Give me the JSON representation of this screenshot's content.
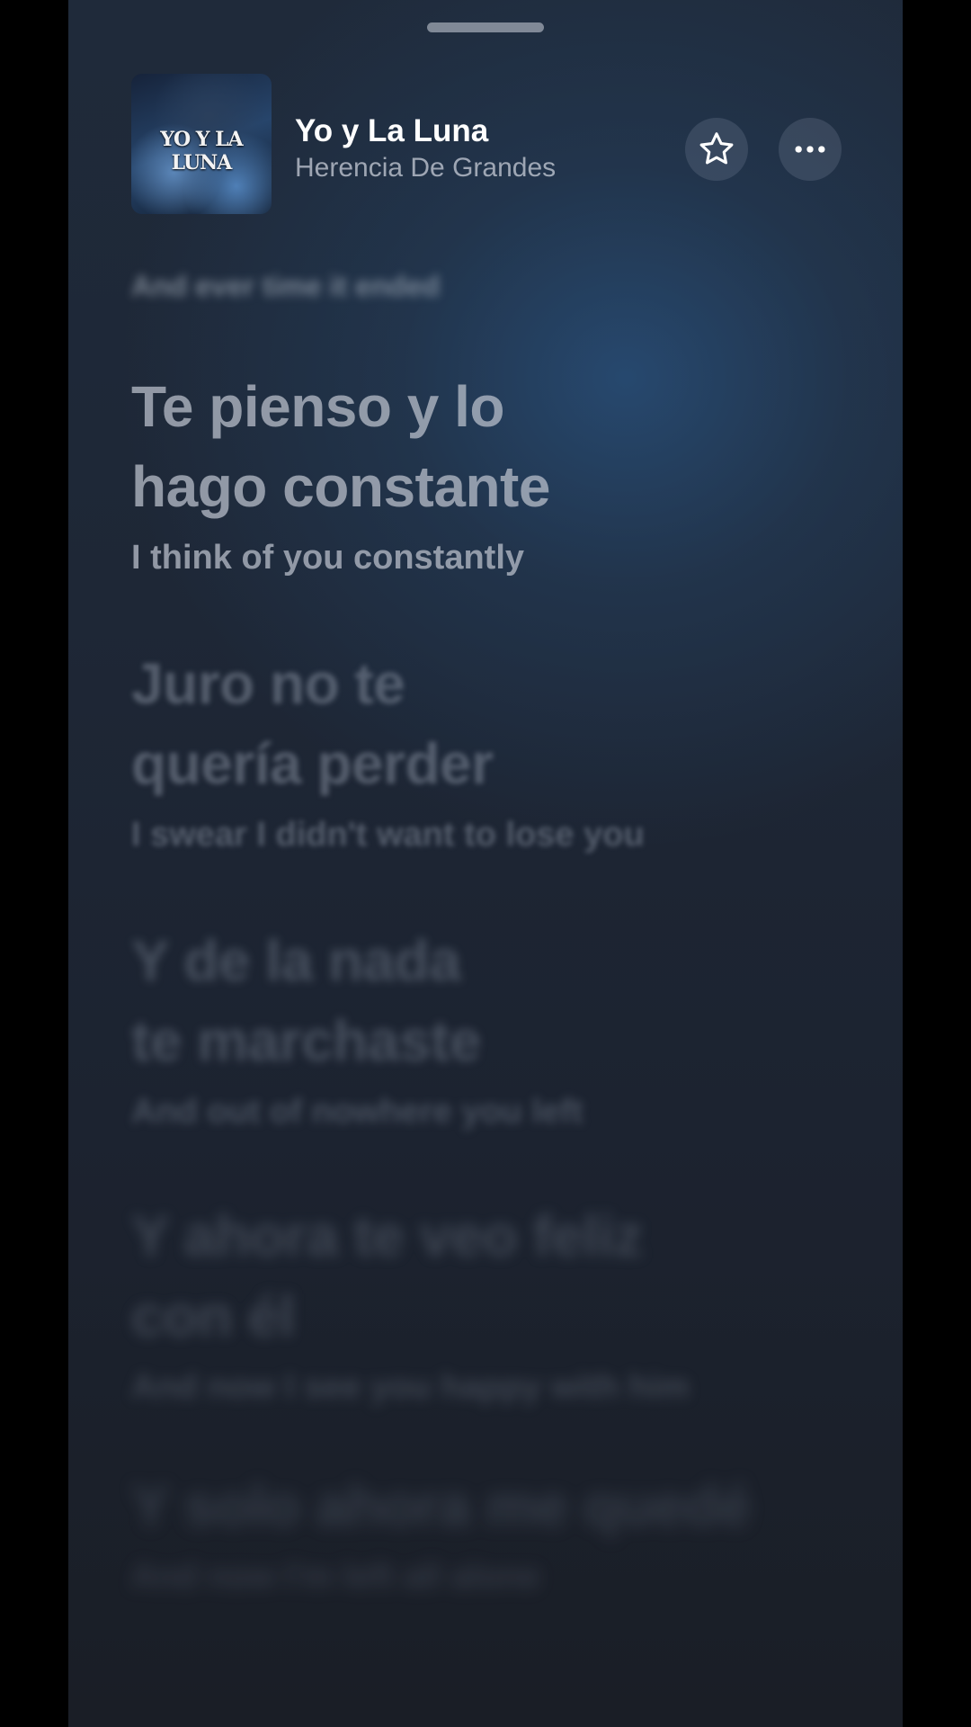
{
  "now_playing": {
    "title": "Yo y La Luna",
    "artist": "Herencia De Grandes",
    "artwork_text": "YO Y LA LUNA"
  },
  "actions": {
    "favorite_icon": "star-icon",
    "more_icon": "ellipsis-icon"
  },
  "lyrics": {
    "previous_translation": "And ever time it ended",
    "lines": [
      {
        "original_1": "Te pienso y lo",
        "original_2": "hago constante",
        "translation": "I think of you constantly"
      },
      {
        "original_1": "Juro no te",
        "original_2": "quería perder",
        "translation": "I swear I didn't want to lose you"
      },
      {
        "original_1": "Y de la nada",
        "original_2": "te marchaste",
        "translation": "And out of nowhere you left"
      },
      {
        "original_1": "Y ahora te veo feliz",
        "original_2": "con él",
        "translation": "And now I see you happy with him"
      },
      {
        "original_1": "Y solo ahora me quedé",
        "original_2": "",
        "translation": "And now I'm left all alone"
      }
    ]
  },
  "colors": {
    "panel_top": "#1f2a3a",
    "panel_glow": "#284e78",
    "panel_bottom": "#1a1e26"
  }
}
